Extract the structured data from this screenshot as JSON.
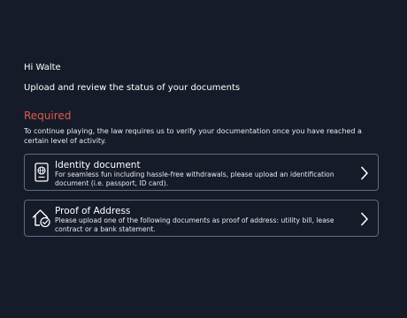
{
  "header": {
    "greeting": "Hi Walte",
    "subtitle": "Upload and review the status of your documents"
  },
  "required_section": {
    "heading": "Required",
    "description": "To continue playing, the law requires us to verify your documentation once you have reached a certain level of activity."
  },
  "documents": [
    {
      "title": "Identity document",
      "text": "For seamless fun including hassle-free withdrawals, please upload an identification document (i.e. passport, ID card).",
      "icon": "passport-icon"
    },
    {
      "title": "Proof of Address",
      "text": "Please upload one of the following documents as proof of address: utility bill, lease contract or a bank statement.",
      "icon": "home-check-icon"
    }
  ],
  "colors": {
    "background": "#151b29",
    "heading_accent": "#e2594a",
    "card_border": "#5f6b82"
  }
}
